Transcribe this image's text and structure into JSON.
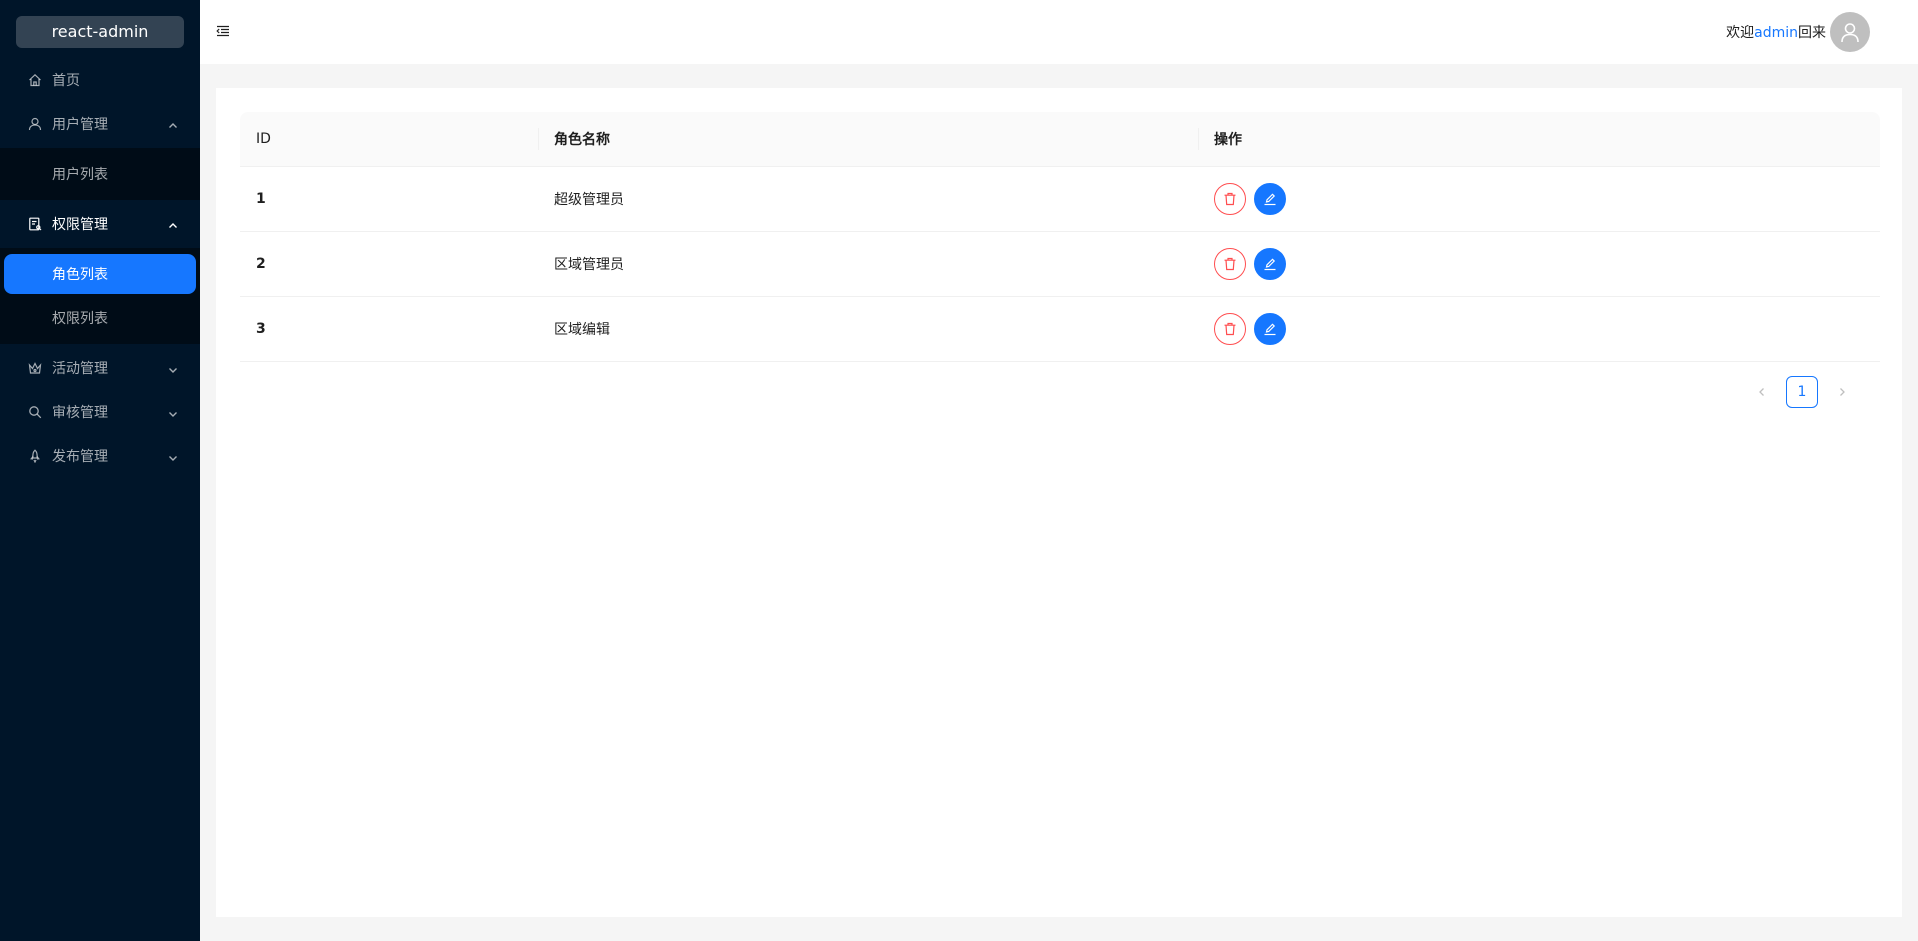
{
  "app": {
    "logo_text": "react-admin"
  },
  "colors": {
    "primary": "#1677ff",
    "danger": "#ff4d4f",
    "sider_bg": "#001529"
  },
  "sidebar": {
    "home": {
      "label": "首页",
      "icon": "home-icon"
    },
    "user_mgmt": {
      "label": "用户管理",
      "icon": "user-icon",
      "children": [
        {
          "label": "用户列表"
        }
      ]
    },
    "perm_mgmt": {
      "label": "权限管理",
      "icon": "audit-icon",
      "children": [
        {
          "label": "角色列表",
          "selected": true
        },
        {
          "label": "权限列表"
        }
      ]
    },
    "activity_mgmt": {
      "label": "活动管理",
      "icon": "crown-icon"
    },
    "review_mgmt": {
      "label": "审核管理",
      "icon": "search-icon"
    },
    "publish_mgmt": {
      "label": "发布管理",
      "icon": "rocket-icon"
    }
  },
  "header": {
    "welcome_prefix": "欢迎",
    "username": "admin",
    "welcome_suffix": "回来"
  },
  "table": {
    "columns": [
      "ID",
      "角色名称",
      "操作"
    ],
    "rows": [
      {
        "id": "1",
        "name": "超级管理员"
      },
      {
        "id": "2",
        "name": "区域管理员"
      },
      {
        "id": "3",
        "name": "区域编辑"
      }
    ]
  },
  "pagination": {
    "current_page": "1"
  }
}
